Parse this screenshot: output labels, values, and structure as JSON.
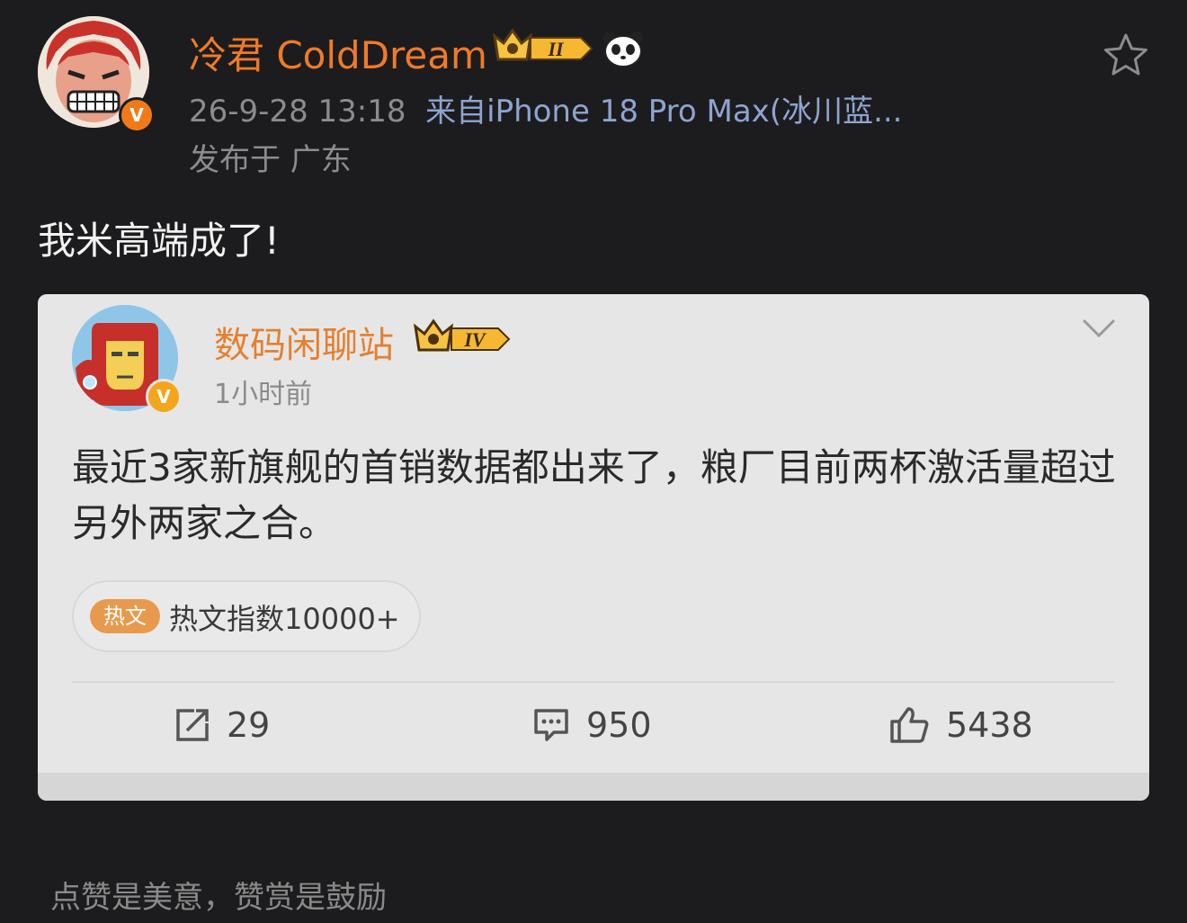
{
  "author": {
    "name": "冷君 ColdDream",
    "crown_level": "II",
    "verified_mark": "V",
    "timestamp": "26-9-28 13:18",
    "source": "来自iPhone 18 Pro Max(冰川蓝...",
    "location": "发布于 广东"
  },
  "post": {
    "text": "我米高端成了!"
  },
  "repost": {
    "author": "数码闲聊站",
    "crown_level": "IV",
    "verified_mark": "V",
    "time": "1小时前",
    "text": "最近3家新旗舰的首销数据都出来了，粮厂目前两杯激活量超过另外两家之合。",
    "hot_tag": "热文",
    "hot_label": "热文指数10000+",
    "actions": {
      "reposts": "29",
      "comments": "950",
      "likes": "5438"
    }
  },
  "footer": {
    "text": "点赞是美意，赞赏是鼓励"
  },
  "colors": {
    "background": "#1c1c1e",
    "name_orange": "#f07a28",
    "card_bg": "#e6e6e6",
    "source_blue": "#8ea4d0"
  },
  "icons": [
    "star-icon",
    "crown-badge",
    "panda-icon",
    "chevron-down-icon",
    "repost-icon",
    "comment-icon",
    "like-icon"
  ]
}
